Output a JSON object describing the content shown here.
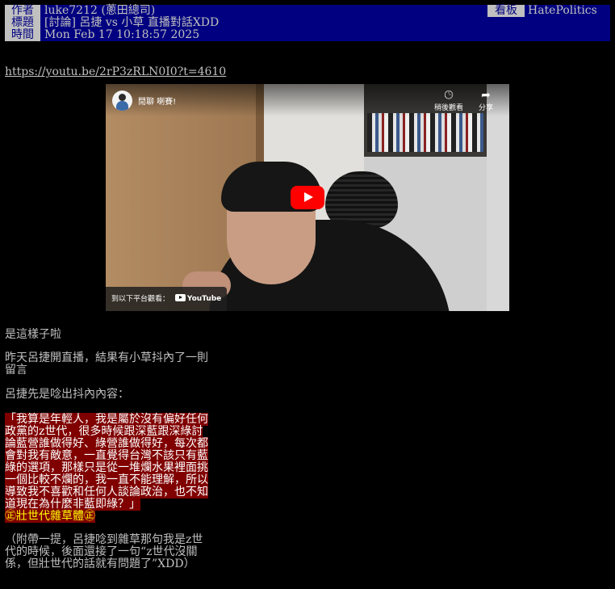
{
  "header": {
    "author_key": "作者",
    "author_value": "luke7212 (蔥田總司)",
    "board_key": "看板",
    "board_value": "HatePolitics",
    "title_key": "標題",
    "title_value": "[討論] 呂捷 vs 小草 直播對話XDD",
    "time_key": "時間",
    "time_value": "Mon Feb 17 10:18:57 2025"
  },
  "link": "https://youtu.be/2rP3zRLN0I0?t=4610",
  "video": {
    "channel_title": "閒聊 喇賽!",
    "watch_later": "稍後觀看",
    "share": "分享",
    "watch_on": "到以下平台觀看：",
    "youtube": "YouTube",
    "icons": [
      "clock-icon",
      "share-arrow-icon",
      "play-icon",
      "youtube-logo-icon"
    ],
    "accent": "#ff0000"
  },
  "body": {
    "p1": "是這樣子啦",
    "p2_lines": [
      "昨天呂捷開直播，結果有小草抖內了一則",
      "留言"
    ],
    "p3": "呂捷先是唸出抖內內容：",
    "quote_lines": [
      "「我算是年輕人，我是屬於沒有偏好任何",
      "政黨的z世代，很多時候跟深藍跟深綠討",
      "論藍營誰做得好、綠營誰做得好，每次都",
      "會對我有敵意，一直覺得台灣不該只有藍",
      "綠的選項，那樣只是從一堆爛水果裡面挑",
      "一個比較不爛的，我一直不能理解，所以",
      "導致我不喜歡和任何人談論政治，也不知",
      "道現在為什麼非藍即綠？」"
    ],
    "highlight": "㊣壯世代雜草體㊣",
    "note_lines": [
      "（附帶一提，呂捷唸到雜草那句我是z世",
      "代的時候，後面還接了一句“z世代沒關",
      "係，但壯世代的話就有問題了”XDD）"
    ]
  }
}
